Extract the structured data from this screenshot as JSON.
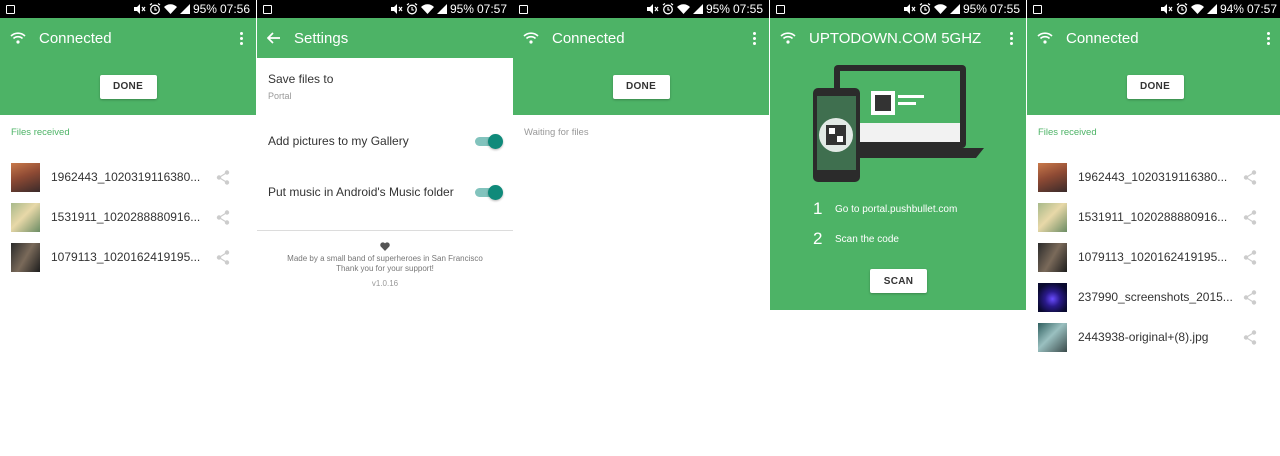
{
  "colors": {
    "primary": "#4db366",
    "accent": "#0f8a7a"
  },
  "screens": [
    {
      "status": {
        "battery": "95%",
        "time": "07:56"
      },
      "appbar": {
        "title": "Connected",
        "icon": "wifi-icon",
        "menu_icon": "more-vert-icon"
      },
      "done_label": "DONE",
      "section_label": "Files received",
      "files": [
        {
          "name": "1962443_1020319116380..."
        },
        {
          "name": "1531911_1020288880916..."
        },
        {
          "name": "1079113_1020162419195..."
        }
      ]
    },
    {
      "status": {
        "battery": "95%",
        "time": "07:57"
      },
      "appbar": {
        "title": "Settings",
        "icon": "back-arrow-icon"
      },
      "save_files": {
        "label": "Save files to",
        "value": "Portal"
      },
      "toggles": [
        {
          "label": "Add pictures to my Gallery",
          "on": true
        },
        {
          "label": "Put music in Android's Music folder",
          "on": true
        }
      ],
      "footer": {
        "icon": "heart-icon",
        "line1": "Made by a small band of superheroes in San Francisco",
        "line2": "Thank you for your support!",
        "version": "v1.0.16"
      }
    },
    {
      "status": {
        "battery": "95%",
        "time": "07:55"
      },
      "appbar": {
        "title": "Connected",
        "icon": "wifi-icon",
        "menu_icon": "more-vert-icon"
      },
      "done_label": "DONE",
      "waiting": "Waiting for files"
    },
    {
      "status": {
        "battery": "95%",
        "time": "07:55"
      },
      "appbar": {
        "title": "UPTODOWN.COM 5GHZ",
        "icon": "wifi-icon",
        "menu_icon": "more-vert-icon"
      },
      "illustration": "phone-laptop-qr-illustration",
      "steps": [
        {
          "num": "1",
          "text": "Go to portal.pushbullet.com"
        },
        {
          "num": "2",
          "text": "Scan the code"
        }
      ],
      "scan_label": "SCAN"
    },
    {
      "status": {
        "battery": "94%",
        "time": "07:57"
      },
      "appbar": {
        "title": "Connected",
        "icon": "wifi-icon",
        "menu_icon": "more-vert-icon"
      },
      "done_label": "DONE",
      "section_label": "Files received",
      "files": [
        {
          "name": "1962443_1020319116380..."
        },
        {
          "name": "1531911_1020288880916..."
        },
        {
          "name": "1079113_1020162419195..."
        },
        {
          "name": "237990_screenshots_2015..."
        },
        {
          "name": "2443938-original+(8).jpg"
        }
      ]
    }
  ]
}
